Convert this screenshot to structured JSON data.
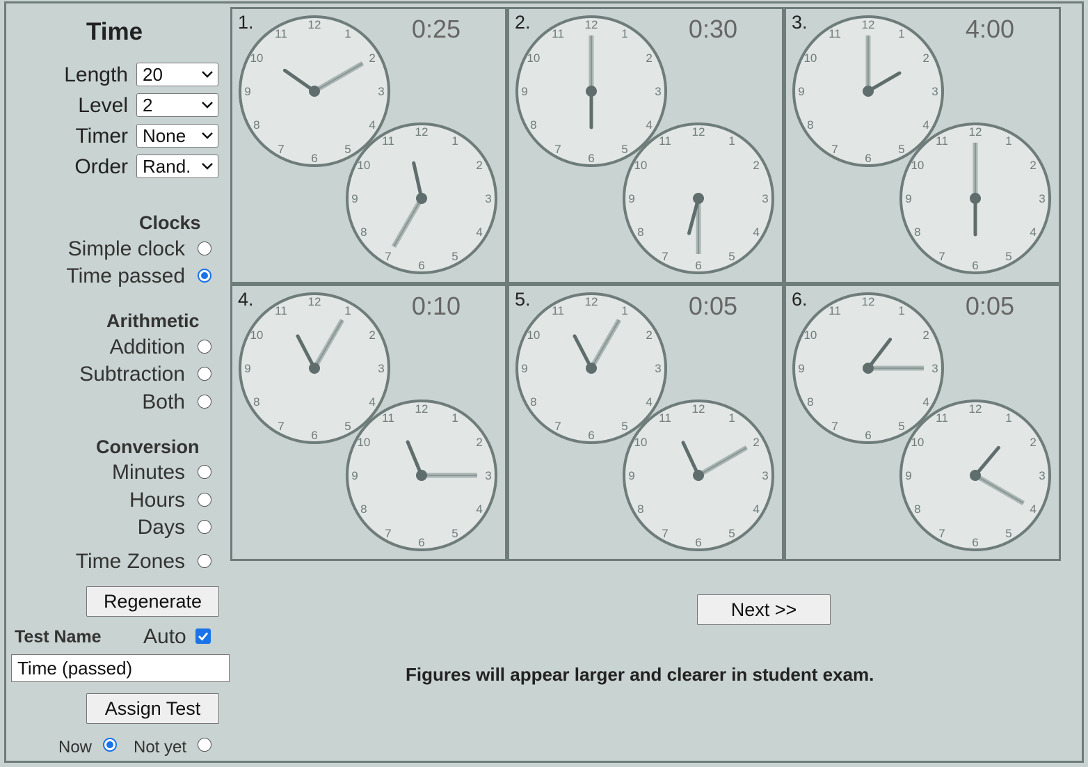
{
  "sidebar": {
    "title": "Time",
    "options": [
      {
        "label": "Length",
        "value": "20"
      },
      {
        "label": "Level",
        "value": "2"
      },
      {
        "label": "Timer",
        "value": "None"
      },
      {
        "label": "Order",
        "value": "Rand."
      }
    ],
    "clocks_heading": "Clocks",
    "clocks": [
      {
        "label": "Simple clock",
        "checked": false
      },
      {
        "label": "Time passed",
        "checked": true
      }
    ],
    "arithmetic_heading": "Arithmetic",
    "arithmetic": [
      {
        "label": "Addition",
        "checked": false
      },
      {
        "label": "Subtraction",
        "checked": false
      },
      {
        "label": "Both",
        "checked": false
      }
    ],
    "conversion_heading": "Conversion",
    "conversion": [
      {
        "label": "Minutes",
        "checked": false
      },
      {
        "label": "Hours",
        "checked": false
      },
      {
        "label": "Days",
        "checked": false
      }
    ],
    "time_zones_label": "Time Zones",
    "regenerate_label": "Regenerate",
    "test_name_label": "Test Name",
    "auto_label": "Auto",
    "auto_checked": true,
    "test_name_value": "Time (passed)",
    "assign_label": "Assign Test",
    "now_label": "Now",
    "not_yet_label": "Not yet"
  },
  "problems": [
    {
      "num": "1.",
      "elapsed": "0:25",
      "start": {
        "h": 10,
        "m": 10
      },
      "end": {
        "h": 11,
        "m": 35
      }
    },
    {
      "num": "2.",
      "elapsed": "0:30",
      "start": {
        "h": 6,
        "m": 0
      },
      "end": {
        "h": 6,
        "m": 30
      }
    },
    {
      "num": "3.",
      "elapsed": "4:00",
      "start": {
        "h": 2,
        "m": 0
      },
      "end": {
        "h": 6,
        "m": 0
      }
    },
    {
      "num": "4.",
      "elapsed": "0:10",
      "start": {
        "h": 11,
        "m": 5
      },
      "end": {
        "h": 11,
        "m": 15
      }
    },
    {
      "num": "5.",
      "elapsed": "0:05",
      "start": {
        "h": 11,
        "m": 5
      },
      "end": {
        "h": 11,
        "m": 10
      }
    },
    {
      "num": "6.",
      "elapsed": "0:05",
      "start": {
        "h": 1,
        "m": 15
      },
      "end": {
        "h": 1,
        "m": 20
      }
    }
  ],
  "next_label": "Next >>",
  "footer_note": "Figures will appear larger and clearer in student exam.",
  "colors": {
    "accent": "#1a73e8",
    "background": "#c9d3d1",
    "clock_stroke": "#6e7c7a",
    "clock_face": "#e2e6e5"
  }
}
